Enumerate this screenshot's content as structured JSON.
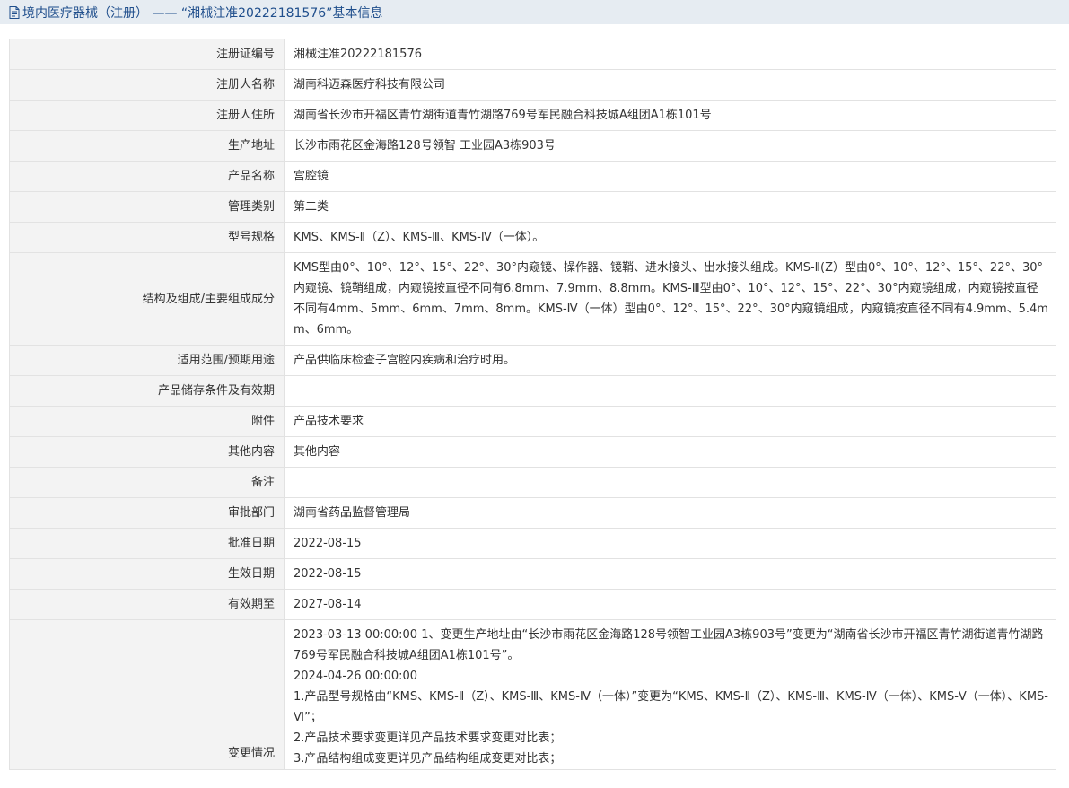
{
  "header": {
    "title": "境内医疗器械（注册） ——  “湘械注准20222181576”基本信息"
  },
  "fields": [
    {
      "label": "注册证编号",
      "value": "湘械注准20222181576"
    },
    {
      "label": "注册人名称",
      "value": "湖南科迈森医疗科技有限公司"
    },
    {
      "label": "注册人住所",
      "value": "湖南省长沙市开福区青竹湖街道青竹湖路769号军民融合科技城A组团A1栋101号"
    },
    {
      "label": "生产地址",
      "value": "长沙市雨花区金海路128号领智 工业园A3栋903号"
    },
    {
      "label": "产品名称",
      "value": "宫腔镜"
    },
    {
      "label": "管理类别",
      "value": "第二类"
    },
    {
      "label": "型号规格",
      "value": "KMS、KMS-Ⅱ（Z）、KMS-Ⅲ、KMS-Ⅳ（一体）。"
    },
    {
      "label": "结构及组成/主要组成成分",
      "value": "KMS型由0°、10°、12°、15°、22°、30°内窥镜、操作器、镜鞘、进水接头、出水接头组成。KMS-Ⅱ(Z）型由0°、10°、12°、15°、22°、30°内窥镜、镜鞘组成，内窥镜按直径不同有6.8mm、7.9mm、8.8mm。KMS-Ⅲ型由0°、10°、12°、15°、22°、30°内窥镜组成，内窥镜按直径不同有4mm、5mm、6mm、7mm、8mm。KMS-Ⅳ（一体）型由0°、12°、15°、22°、30°内窥镜组成，内窥镜按直径不同有4.9mm、5.4mm、6mm。"
    },
    {
      "label": "适用范围/预期用途",
      "value": "产品供临床检查子宫腔内疾病和治疗时用。"
    },
    {
      "label": "产品储存条件及有效期",
      "value": ""
    },
    {
      "label": "附件",
      "value": "产品技术要求"
    },
    {
      "label": "其他内容",
      "value": "其他内容"
    },
    {
      "label": "备注",
      "value": ""
    },
    {
      "label": "审批部门",
      "value": "湖南省药品监督管理局"
    },
    {
      "label": "批准日期",
      "value": "2022-08-15"
    },
    {
      "label": "生效日期",
      "value": "2022-08-15"
    },
    {
      "label": "有效期至",
      "value": "2027-08-14"
    }
  ],
  "change": {
    "label": "变更情况",
    "lines": [
      "2023-03-13 00:00:00 1、变更生产地址由“长沙市雨花区金海路128号领智工业园A3栋903号”变更为“湖南省长沙市开福区青竹湖街道青竹湖路769号军民融合科技城A组团A1栋101号”。",
      "2024-04-26 00:00:00",
      "1.产品型号规格由“KMS、KMS-Ⅱ（Z）、KMS-Ⅲ、KMS-Ⅳ（一体）”变更为“KMS、KMS-Ⅱ（Z）、KMS-Ⅲ、KMS-Ⅳ（一体）、KMS-Ⅴ（一体）、KMS-Ⅵ”；",
      "2.产品技术要求变更详见产品技术要求变更对比表；",
      "3.产品结构组成变更详见产品结构组成变更对比表；"
    ]
  }
}
